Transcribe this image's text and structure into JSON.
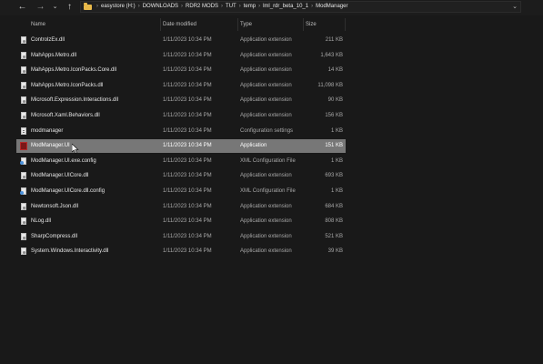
{
  "nav": {
    "back_icon": "arrow-left-icon",
    "forward_icon": "arrow-right-icon",
    "recent_icon": "chevron-down-icon",
    "up_icon": "arrow-up-icon"
  },
  "breadcrumb": [
    "easystore (H:)",
    "DOWNLOADS",
    "RDR2 MODS",
    "TUT",
    "temp",
    "lml_rdr_beta_10_1",
    "ModManager"
  ],
  "columns": {
    "name": "Name",
    "date": "Date modified",
    "type": "Type",
    "size": "Size"
  },
  "files": [
    {
      "name": "ControlzEx.dll",
      "date": "1/11/2023 10:34 PM",
      "type": "Application extension",
      "size": "211 KB",
      "icon": "dll-file-icon"
    },
    {
      "name": "MahApps.Metro.dll",
      "date": "1/11/2023 10:34 PM",
      "type": "Application extension",
      "size": "1,643 KB",
      "icon": "dll-file-icon"
    },
    {
      "name": "MahApps.Metro.IconPacks.Core.dll",
      "date": "1/11/2023 10:34 PM",
      "type": "Application extension",
      "size": "14 KB",
      "icon": "dll-file-icon"
    },
    {
      "name": "MahApps.Metro.IconPacks.dll",
      "date": "1/11/2023 10:34 PM",
      "type": "Application extension",
      "size": "11,098 KB",
      "icon": "dll-file-icon"
    },
    {
      "name": "Microsoft.Expression.Interactions.dll",
      "date": "1/11/2023 10:34 PM",
      "type": "Application extension",
      "size": "90 KB",
      "icon": "dll-file-icon"
    },
    {
      "name": "Microsoft.Xaml.Behaviors.dll",
      "date": "1/11/2023 10:34 PM",
      "type": "Application extension",
      "size": "156 KB",
      "icon": "dll-file-icon"
    },
    {
      "name": "modmanager",
      "date": "1/11/2023 10:34 PM",
      "type": "Configuration settings",
      "size": "1 KB",
      "icon": "config-file-icon"
    },
    {
      "name": "ModManager.UI",
      "date": "1/11/2023 10:34 PM",
      "type": "Application",
      "size": "151 KB",
      "icon": "application-icon",
      "selected": true
    },
    {
      "name": "ModManager.UI.exe.config",
      "date": "1/11/2023 10:34 PM",
      "type": "XML Configuration File",
      "size": "1 KB",
      "icon": "xml-config-file-icon"
    },
    {
      "name": "ModManager.UICore.dll",
      "date": "1/11/2023 10:34 PM",
      "type": "Application extension",
      "size": "693 KB",
      "icon": "dll-file-icon"
    },
    {
      "name": "ModManager.UICore.dll.config",
      "date": "1/11/2023 10:34 PM",
      "type": "XML Configuration File",
      "size": "1 KB",
      "icon": "xml-config-file-icon"
    },
    {
      "name": "Newtonsoft.Json.dll",
      "date": "1/11/2023 10:34 PM",
      "type": "Application extension",
      "size": "684 KB",
      "icon": "dll-file-icon"
    },
    {
      "name": "NLog.dll",
      "date": "1/11/2023 10:34 PM",
      "type": "Application extension",
      "size": "808 KB",
      "icon": "dll-file-icon"
    },
    {
      "name": "SharpCompress.dll",
      "date": "1/11/2023 10:34 PM",
      "type": "Application extension",
      "size": "521 KB",
      "icon": "dll-file-icon"
    },
    {
      "name": "System.Windows.Interactivity.dll",
      "date": "1/11/2023 10:34 PM",
      "type": "Application extension",
      "size": "39 KB",
      "icon": "dll-file-icon"
    }
  ],
  "colors": {
    "background": "#191919",
    "selected_row": "#777777",
    "folder": "#e8b94a"
  }
}
